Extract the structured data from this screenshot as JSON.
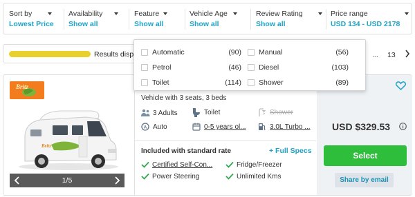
{
  "filters": [
    {
      "label": "Sort by",
      "value": "Lowest Price"
    },
    {
      "label": "Availability",
      "value": "Show all"
    },
    {
      "label": "Feature",
      "value": "Show all"
    },
    {
      "label": "Vehicle Age",
      "value": "Show all"
    },
    {
      "label": "Review Rating",
      "value": "Show all"
    },
    {
      "label": "Price range",
      "value": "USD 134 - USD 2178"
    }
  ],
  "results": {
    "text": "Results displayed",
    "progress": 1.0,
    "pager_ellipsis": "...",
    "pager_last": "13"
  },
  "feature_dropdown": {
    "options": [
      {
        "label": "Automatic",
        "count": "(90)"
      },
      {
        "label": "Manual",
        "count": "(56)"
      },
      {
        "label": "Petrol",
        "count": "(46)"
      },
      {
        "label": "Diesel",
        "count": "(103)"
      },
      {
        "label": "Toilet",
        "count": "(114)"
      },
      {
        "label": "Shower",
        "count": "(89)"
      }
    ]
  },
  "card": {
    "logo_text": "Britz",
    "gallery_count": "1/5",
    "vehicle_title": "Vehicle with 3 seats, 3 beds",
    "specs": {
      "adults": "3 Adults",
      "toilet": "Toilet",
      "shower": "Shower",
      "transmission": "Auto",
      "age": "0-5 years ol...",
      "engine": "3.0L Turbo ..."
    },
    "included_title": "Included with standard rate",
    "full_specs": "+ Full Specs",
    "included": [
      "Certified Self-Con...",
      "Fridge/Freezer",
      "Power Steering",
      "Unlimited Kms"
    ],
    "price": "USD $329.53",
    "select_label": "Select",
    "share_label": "Share by email"
  },
  "colors": {
    "accent": "#1ea3c6",
    "select_green": "#2fbd3c",
    "check_green": "#2fa84f",
    "logo_orange": "#f27c1e",
    "progress_yellow": "#e8d12a"
  }
}
